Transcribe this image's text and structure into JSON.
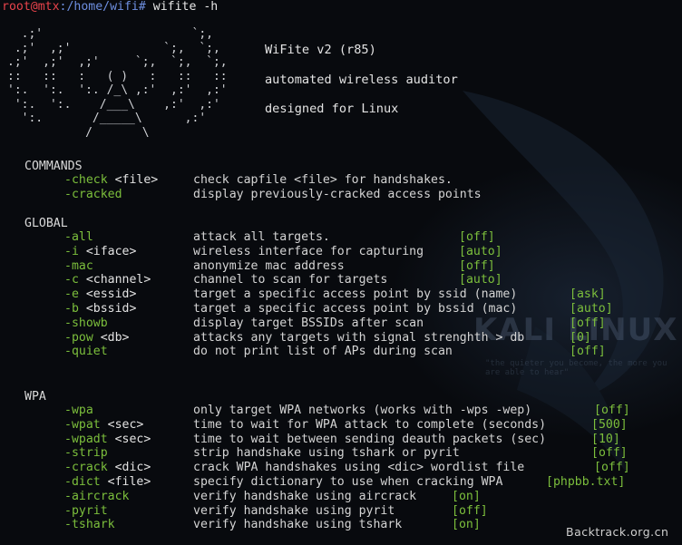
{
  "terminal": {
    "prompt_user_host": "root@mtx",
    "prompt_path": ":/home/wifi#",
    "command": " wifite -h"
  },
  "ascii_art": "  .;'                     `;,\n .;'  ,;'             `;,  `;,\n.;'  ,;'  ,;'     `;,  `;,  `;,\n::   ::   :   ( )   :   ::   ::\n':.  ':.  ':. /_\\ ,:'  ,:'  ,:'\n ':.  ':.    /___\\    ,:'  ,:'\n  ':.       /_____\\      ,:'\n           /       \\",
  "banner": {
    "title": "WiFite v2 (r85)",
    "subtitle": "automated wireless auditor",
    "platform": "designed for Linux"
  },
  "sections": {
    "commands": "COMMANDS",
    "global": "GLOBAL",
    "wpa": "WPA"
  },
  "commands": [
    {
      "flag": "-check",
      "arg": " <file>",
      "desc": "check capfile <file> for handshakes.",
      "default": ""
    },
    {
      "flag": "-cracked",
      "arg": "",
      "desc": "display previously-cracked access points",
      "default": ""
    }
  ],
  "global": [
    {
      "flag": "-all",
      "arg": "",
      "desc": "attack all targets.",
      "default": "[off]"
    },
    {
      "flag": "-i",
      "arg": " <iface>",
      "desc": "wireless interface for capturing",
      "default": "[auto]"
    },
    {
      "flag": "-mac",
      "arg": "",
      "desc": "anonymize mac address",
      "default": "[off]"
    },
    {
      "flag": "-c",
      "arg": " <channel>",
      "desc": "channel to scan for targets",
      "default": "[auto]"
    },
    {
      "flag": "-e",
      "arg": " <essid>",
      "desc": "target a specific access point by ssid (name)",
      "default": "[ask]"
    },
    {
      "flag": "-b",
      "arg": " <bssid>",
      "desc": "target a specific access point by bssid (mac)",
      "default": "[auto]"
    },
    {
      "flag": "-showb",
      "arg": "",
      "desc": "display target BSSIDs after scan",
      "default": "[off]"
    },
    {
      "flag": "-pow",
      "arg": " <db>",
      "desc": "attacks any targets with signal strenghth > db",
      "default": "[0]"
    },
    {
      "flag": "-quiet",
      "arg": "",
      "desc": "do not print list of APs during scan",
      "default": "[off]"
    }
  ],
  "wpa": [
    {
      "flag": "-wpa",
      "arg": "",
      "desc": "only target WPA networks (works with -wps -wep)",
      "default": "[off]"
    },
    {
      "flag": "-wpat",
      "arg": " <sec>",
      "desc": "time to wait for WPA attack to complete (seconds)",
      "default": "[500]"
    },
    {
      "flag": "-wpadt",
      "arg": " <sec>",
      "desc": "time to wait between sending deauth packets (sec)",
      "default": "[10]"
    },
    {
      "flag": "-strip",
      "arg": "",
      "desc": "strip handshake using tshark or pyrit",
      "default": "[off]"
    },
    {
      "flag": "-crack",
      "arg": " <dic>",
      "desc": "crack WPA handshakes using <dic> wordlist file",
      "default": "[off]"
    },
    {
      "flag": "-dict",
      "arg": " <file>",
      "desc": "specify dictionary to use when cracking WPA",
      "default": "[phpbb.txt]"
    },
    {
      "flag": "-aircrack",
      "arg": "",
      "desc": "verify handshake using aircrack",
      "default": "[on]"
    },
    {
      "flag": "-pyrit",
      "arg": "",
      "desc": "verify handshake using pyrit",
      "default": "[off]"
    },
    {
      "flag": "-tshark",
      "arg": "",
      "desc": "verify handshake using tshark",
      "default": "[on]"
    }
  ],
  "wallpaper": {
    "logo_text": "KALI LINUX",
    "tagline": "\"the quieter you become, the more you are able to hear\""
  },
  "watermark": "Backtrack.org.cn",
  "colors": {
    "background": "#080a0e",
    "flag_green": "#7cbf3c",
    "prompt_red": "#e8434b",
    "prompt_blue": "#6e8fe0"
  }
}
